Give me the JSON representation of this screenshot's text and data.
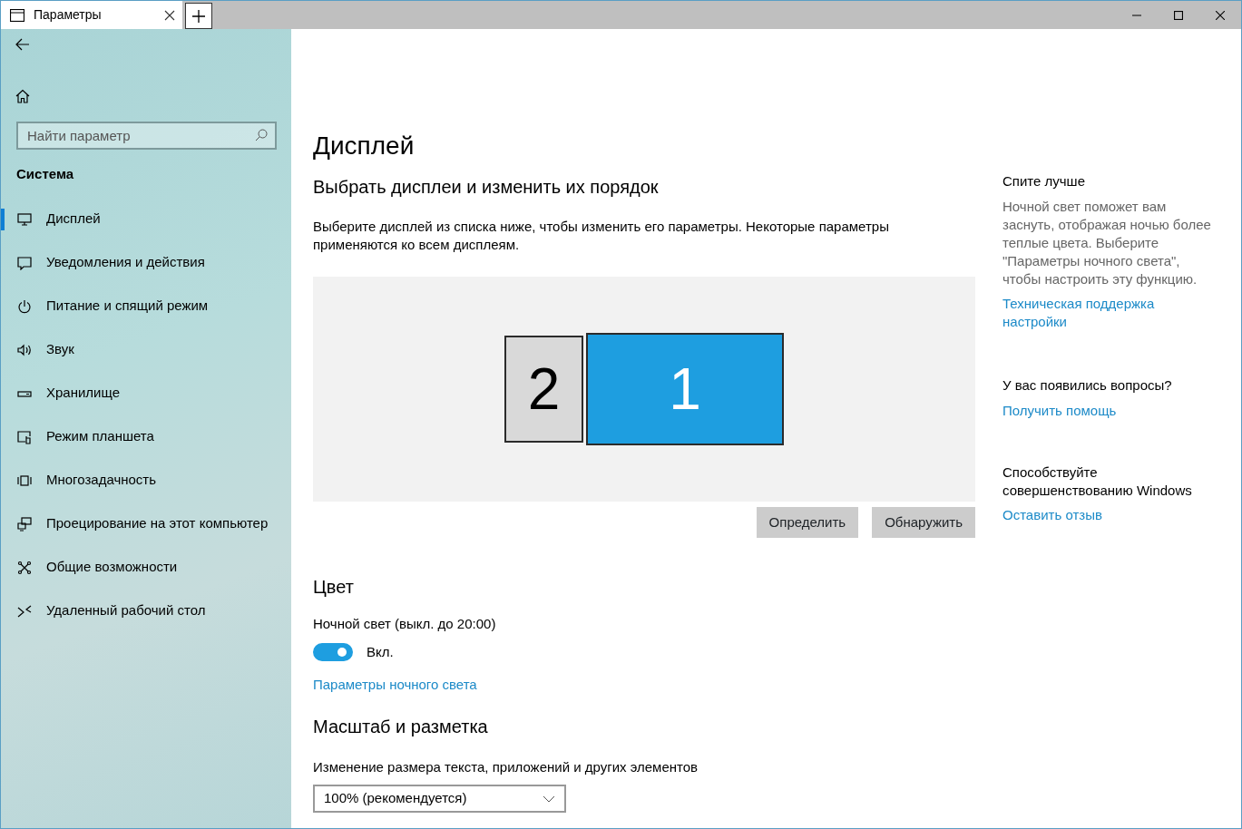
{
  "window": {
    "tab_title": "Параметры",
    "selected": true
  },
  "sidebar": {
    "search": {
      "placeholder": "Найти параметр"
    },
    "heading": "Система",
    "items": [
      {
        "label": "Дисплей",
        "selected": true
      },
      {
        "label": "Уведомления и действия",
        "selected": false
      },
      {
        "label": "Питание и спящий режим",
        "selected": false
      },
      {
        "label": "Звук",
        "selected": false
      },
      {
        "label": "Хранилище",
        "selected": false
      },
      {
        "label": "Режим планшета",
        "selected": false
      },
      {
        "label": "Многозадачность",
        "selected": false
      },
      {
        "label": "Проецирование на этот компьютер",
        "selected": false
      },
      {
        "label": "Общие возможности",
        "selected": false
      },
      {
        "label": "Удаленный рабочий стол",
        "selected": false
      }
    ]
  },
  "main": {
    "title": "Дисплей",
    "arrange": {
      "heading": "Выбрать дисплеи и изменить их порядок",
      "description": "Выберите дисплей из списка ниже, чтобы изменить его параметры. Некоторые параметры применяются ко всем дисплеям.",
      "monitors": [
        {
          "label": "2",
          "selected": false
        },
        {
          "label": "1",
          "selected": true
        }
      ],
      "buttons": [
        "Определить",
        "Обнаружить"
      ]
    },
    "color": {
      "heading": "Цвет",
      "night_light_label": "Ночной свет (выкл. до 20:00)",
      "toggle": {
        "on": true,
        "label": "Вкл."
      },
      "link": "Параметры ночного света"
    },
    "scale": {
      "heading": "Масштаб и разметка",
      "label": "Изменение размера текста, приложений и других элементов",
      "dropdown": "100% (рекомендуется)"
    }
  },
  "aside": [
    {
      "heading": "Спите лучше",
      "text": "Ночной свет поможет вам заснуть, отображая ночью более теплые цвета. Выберите \"Параметры ночного света\", чтобы настроить эту функцию.",
      "links": [
        "Техническая поддержка настройки"
      ]
    },
    {
      "heading": "У вас появились вопросы?",
      "links": [
        "Получить помощь"
      ]
    },
    {
      "heading": "Способствуйте совершенствованию Windows",
      "links": [
        "Оставить отзыв"
      ]
    }
  ]
}
